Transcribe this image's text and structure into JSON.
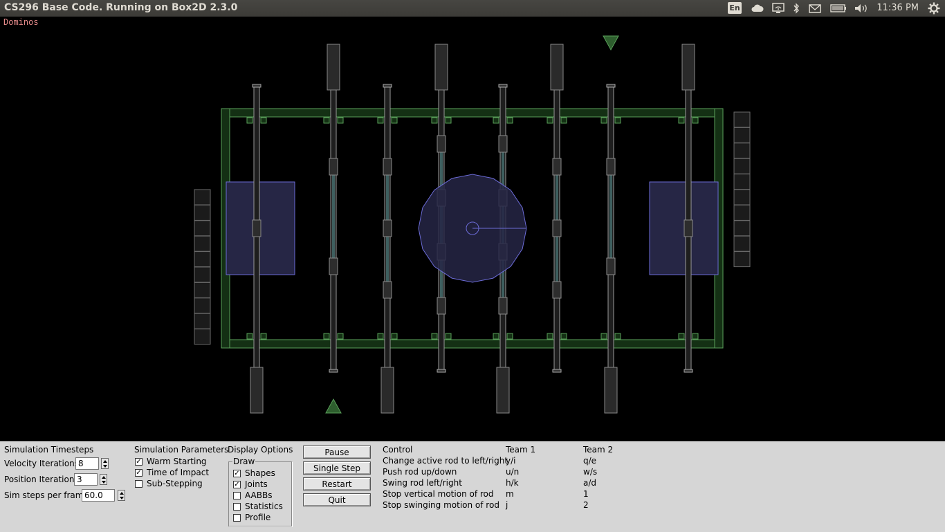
{
  "window": {
    "title": "CS296 Base Code. Running on Box2D 2.3.0"
  },
  "system_tray": {
    "keyboard_layout": "En",
    "clock": "11:36 PM",
    "icons": [
      "keyboard-layout-icon",
      "cloud-icon",
      "network-icon",
      "bluetooth-icon",
      "mail-icon",
      "battery-icon",
      "volume-icon",
      "gear-icon"
    ]
  },
  "scene": {
    "label": "Dominos",
    "colors": {
      "frame": "#5aa05a",
      "frame_fill": "#0d1a0d",
      "rod": "#aaaaaa",
      "handle": "#2a2a2a",
      "ball": "#6b6bd6",
      "goal": "#6b6bd6",
      "triangle": "#2e5e2e",
      "bumper": "#1b1b1b"
    }
  },
  "control_panel": {
    "timesteps": {
      "heading": "Simulation Timesteps",
      "velocity_label": "Velocity Iterations",
      "velocity_value": "8",
      "position_label": "Position Iterations",
      "position_value": "3",
      "hz_label": "Sim steps per frame",
      "hz_value": "60.0"
    },
    "parameters": {
      "heading": "Simulation Parameters",
      "items": [
        {
          "label": "Warm Starting",
          "checked": true
        },
        {
          "label": "Time of Impact",
          "checked": true
        },
        {
          "label": "Sub-Stepping",
          "checked": false
        }
      ]
    },
    "display": {
      "heading": "Display Options",
      "group_label": "Draw",
      "items": [
        {
          "label": "Shapes",
          "checked": true
        },
        {
          "label": "Joints",
          "checked": true
        },
        {
          "label": "AABBs",
          "checked": false
        },
        {
          "label": "Statistics",
          "checked": false
        },
        {
          "label": "Profile",
          "checked": false
        }
      ]
    },
    "buttons": {
      "pause": "Pause",
      "single_step": "Single Step",
      "restart": "Restart",
      "quit": "Quit"
    },
    "controls_table": {
      "headers": [
        "Control",
        "Team 1",
        "Team 2"
      ],
      "rows": [
        [
          "Change active rod to left/right",
          "y/i",
          "q/e"
        ],
        [
          "Push rod up/down",
          "u/n",
          "w/s"
        ],
        [
          "Swing rod left/right",
          "h/k",
          "a/d"
        ],
        [
          "Stop vertical motion of rod",
          "m",
          "1"
        ],
        [
          "Stop swinging motion of rod",
          "j",
          "2"
        ]
      ]
    }
  }
}
